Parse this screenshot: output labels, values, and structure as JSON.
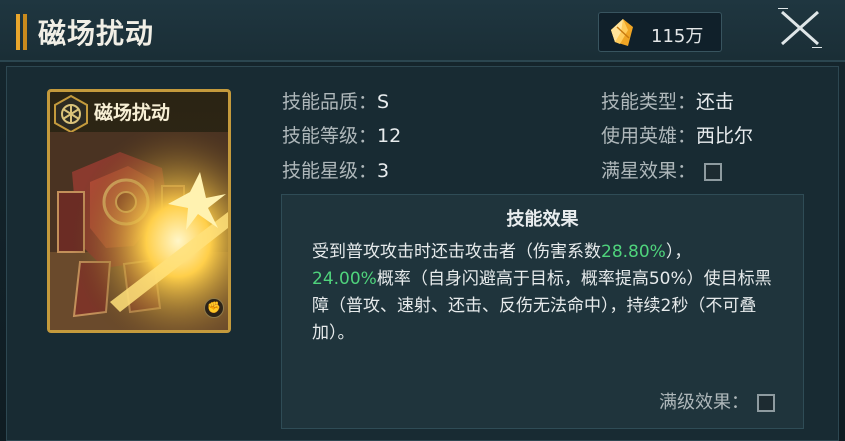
{
  "header": {
    "title": "磁场扰动",
    "currency_value": "115万",
    "currency_icon": "crystal-icon",
    "close_icon": "close-icon"
  },
  "card": {
    "title": "磁场扰动",
    "quality_icon": "hex-emblem-icon",
    "type_icon": "fist-icon",
    "frame_color": "#c49a3c"
  },
  "info": {
    "quality_label": "技能品质：",
    "quality_value": "S",
    "level_label": "技能等级：",
    "level_value": "12",
    "star_label": "技能星级：",
    "star_value": "3",
    "type_label": "技能类型：",
    "type_value": "还击",
    "hero_label": "使用英雄：",
    "hero_value": "西比尔",
    "fullstar_label": "满星效果："
  },
  "effect": {
    "title": "技能效果",
    "line1_a": "受到普攻攻击时还击攻击者（伤害系数",
    "line1_green": "28.80%",
    "line1_b": "），",
    "line2_green": "24.00%",
    "line2_b": "概率（自身闪避高于目标，概率提高50%）使目标黑障（普攻、速射、还击、反伤无法命中），持续2秒（不可叠加）。",
    "maxlevel_label": "满级效果：",
    "highlight_color": "#4fd37c"
  }
}
